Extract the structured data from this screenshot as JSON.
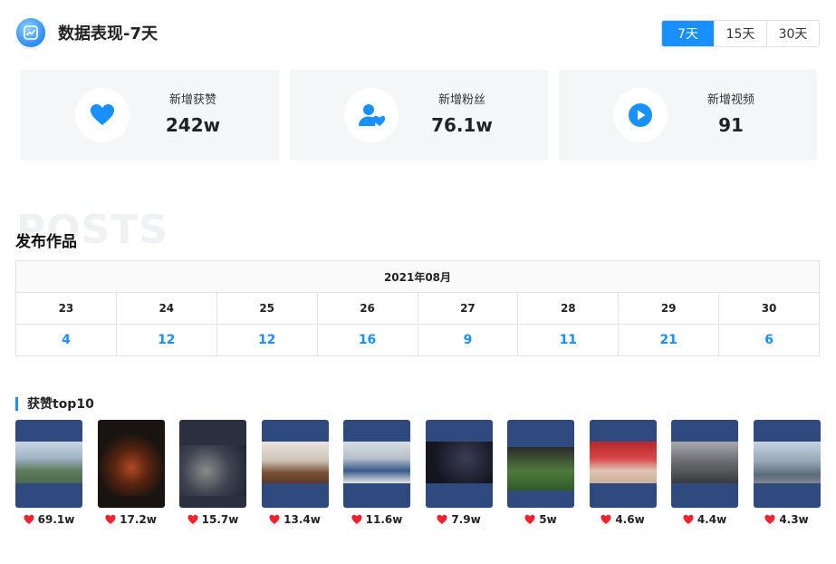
{
  "header": {
    "title": "数据表现-7天",
    "ranges": [
      "7天",
      "15天",
      "30天"
    ],
    "active_range": "7天"
  },
  "stats": [
    {
      "label": "新增获赞",
      "value": "242w",
      "icon": "heart-icon"
    },
    {
      "label": "新增粉丝",
      "value": "76.1w",
      "icon": "user-add-icon"
    },
    {
      "label": "新增视频",
      "value": "91",
      "icon": "play-icon"
    }
  ],
  "posts": {
    "watermark": "POSTS",
    "title": "发布作品",
    "month": "2021年08月",
    "days": [
      "23",
      "24",
      "25",
      "26",
      "27",
      "28",
      "29",
      "30"
    ],
    "counts": [
      "4",
      "12",
      "12",
      "16",
      "9",
      "11",
      "21",
      "6"
    ]
  },
  "top10": {
    "title": "获赞top10",
    "items": [
      {
        "likes": "69.1w",
        "photo": "city"
      },
      {
        "likes": "17.2w",
        "photo": "night-fire"
      },
      {
        "likes": "15.7w",
        "photo": "street-night"
      },
      {
        "likes": "13.4w",
        "photo": "courtroom"
      },
      {
        "likes": "11.6w",
        "photo": "office"
      },
      {
        "likes": "7.9w",
        "photo": "dark-car"
      },
      {
        "likes": "5w",
        "photo": "grass"
      },
      {
        "likes": "4.6w",
        "photo": "meeting"
      },
      {
        "likes": "4.4w",
        "photo": "motorbike"
      },
      {
        "likes": "4.3w",
        "photo": "skyline"
      }
    ]
  },
  "colors": {
    "accent": "#1890ff",
    "card_bg": "#f5f6f8",
    "heart": "#f5222d",
    "thumb_bg": "#2f4a7e",
    "caption": "#ffd84a"
  }
}
